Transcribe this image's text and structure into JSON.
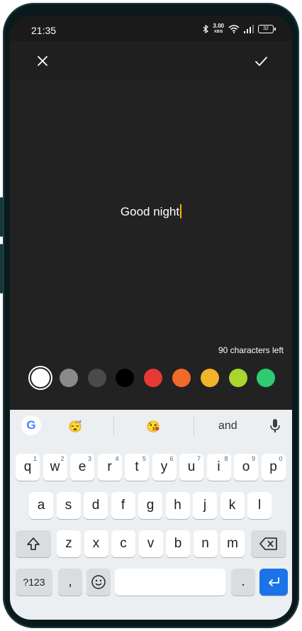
{
  "status_bar": {
    "time": "21:35",
    "speed_value": "3.00",
    "speed_unit": "KB/S",
    "battery": "32"
  },
  "toolbar": {
    "close_icon": "close-icon",
    "confirm_icon": "check-icon"
  },
  "editor": {
    "text": "Good night",
    "counter": "90 characters left"
  },
  "colors": [
    "#ffffff",
    "#8a8a8a",
    "#4a4a4a",
    "#000000",
    "#e53935",
    "#f06a2a",
    "#f2b42b",
    "#a9d62e",
    "#2ecc71"
  ],
  "keyboard": {
    "suggestions": [
      "😴",
      "😘",
      "and"
    ],
    "row1": [
      {
        "k": "q",
        "h": "1"
      },
      {
        "k": "w",
        "h": "2"
      },
      {
        "k": "e",
        "h": "3"
      },
      {
        "k": "r",
        "h": "4"
      },
      {
        "k": "t",
        "h": "5"
      },
      {
        "k": "y",
        "h": "6"
      },
      {
        "k": "u",
        "h": "7"
      },
      {
        "k": "i",
        "h": "8"
      },
      {
        "k": "o",
        "h": "9"
      },
      {
        "k": "p",
        "h": "0"
      }
    ],
    "row2": [
      "a",
      "s",
      "d",
      "f",
      "g",
      "h",
      "j",
      "k",
      "l"
    ],
    "row3": [
      "z",
      "x",
      "c",
      "v",
      "b",
      "n",
      "m"
    ],
    "symbols_label": "?123",
    "comma_label": ",",
    "period_label": "."
  }
}
